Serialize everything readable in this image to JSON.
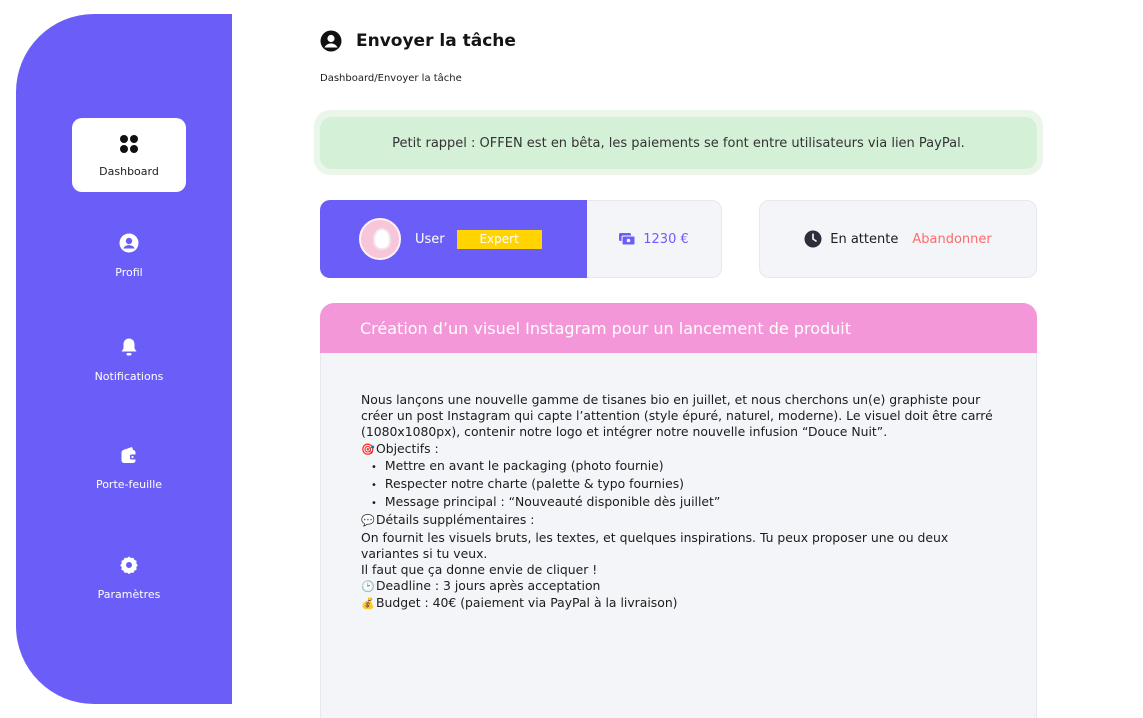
{
  "sidebar": {
    "items": [
      {
        "label": "Dashboard",
        "icon": "apps-icon",
        "active": true
      },
      {
        "label": "Profil",
        "icon": "user-icon",
        "active": false
      },
      {
        "label": "Notifications",
        "icon": "bell-icon",
        "active": false
      },
      {
        "label": "Porte-feuille",
        "icon": "wallet-icon",
        "active": false
      },
      {
        "label": "Paramètres",
        "icon": "gear-icon",
        "active": false
      }
    ]
  },
  "header": {
    "title": "Envoyer la tâche",
    "breadcrumb": "Dashboard/Envoyer la tâche"
  },
  "reminder": "Petit rappel : OFFEN est en bêta, les paiements se font entre utilisateurs via lien PayPal.",
  "user": {
    "name": "User",
    "badge": "Expert",
    "balance": "1230 €"
  },
  "status": {
    "label": "En attente",
    "action": "Abandonner"
  },
  "task": {
    "title": "Création d’un visuel Instagram pour un lancement de produit",
    "intro": "Nous lançons une nouvelle gamme de tisanes bio en juillet, et nous cherchons un(e) graphiste pour créer un post Instagram qui capte l’attention (style épuré, naturel, moderne). Le visuel doit être carré (1080x1080px), contenir notre logo et intégrer notre nouvelle infusion “Douce Nuit”.",
    "objectives_title": "Objectifs :",
    "objectives": [
      "Mettre en avant le packaging (photo fournie)",
      "Respecter notre charte (palette & typo fournies)",
      "Message principal : “Nouveauté disponible dès juillet”"
    ],
    "details_title": "Détails supplémentaires :",
    "details": "On fournit les visuels bruts, les textes, et quelques inspirations. Tu peux proposer une ou deux variantes si tu veux.",
    "closing": "Il faut que ça donne envie de cliquer !",
    "deadline": "Deadline : 3 jours après acceptation",
    "budget": "Budget : 40€ (paiement via PayPal à la livraison)"
  },
  "colors": {
    "accent": "#6b5ef8",
    "reminder_bg": "#d4f0d6",
    "task_header": "#f397d9",
    "badge": "#ffd400",
    "danger": "#ff6b6b"
  }
}
